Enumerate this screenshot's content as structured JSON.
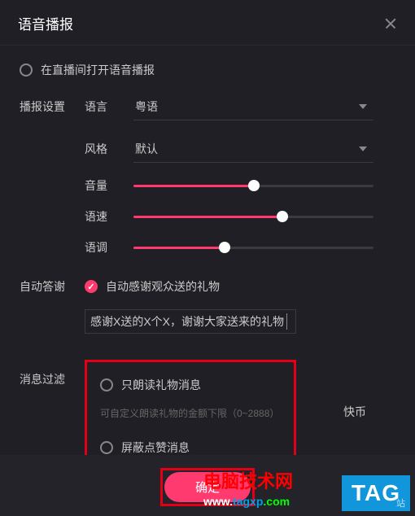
{
  "header": {
    "title": "语音播报"
  },
  "enable": {
    "label": "在直播间打开语音播报"
  },
  "settings": {
    "section_label": "播报设置",
    "language": {
      "label": "语言",
      "value": "粤语"
    },
    "style": {
      "label": "风格",
      "value": "默认"
    },
    "volume": {
      "label": "音量",
      "percent": 50
    },
    "speed": {
      "label": "语速",
      "percent": 62
    },
    "pitch": {
      "label": "语调",
      "percent": 38
    }
  },
  "auto_reply": {
    "section_label": "自动答谢",
    "thank_gifts_label": "自动感谢观众送的礼物",
    "template_prefix": "感谢X送的X个X，",
    "template_editable": "谢谢大家送来的礼物"
  },
  "filter": {
    "section_label": "消息过滤",
    "only_gifts_label": "只朗读礼物消息",
    "amount_hint": "可自定义朗读礼物的金额下限（0~2888）",
    "unit": "快币",
    "block_likes_label": "屏蔽点赞消息"
  },
  "footer": {
    "confirm": "确定"
  },
  "watermark": {
    "line1": "电脑技术网",
    "url_w": "www.",
    "url_t": "tagxp",
    "url_c": ".com",
    "tag": "TAG",
    "station": "站"
  }
}
